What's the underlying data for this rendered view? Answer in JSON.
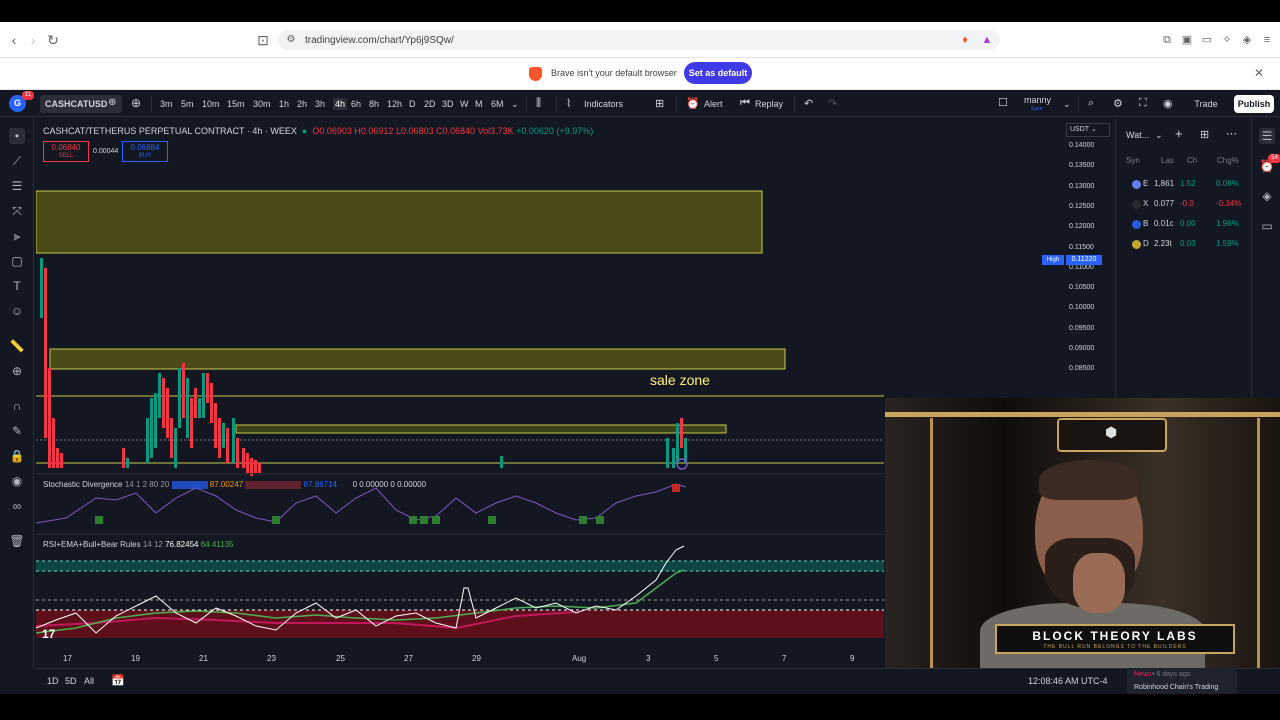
{
  "browser": {
    "url": "tradingview.com/chart/Yp6j9SQw/",
    "notification_text": "Brave isn't your default browser",
    "notification_button": "Set as default"
  },
  "toolbar": {
    "avatar_letter": "G",
    "avatar_badge": "11",
    "symbol": "CASHCATUSD",
    "intervals": [
      "3m",
      "5m",
      "10m",
      "15m",
      "30m",
      "1h",
      "2h",
      "3h",
      "4h",
      "6h",
      "8h",
      "12h",
      "D",
      "2D",
      "3D",
      "W",
      "M",
      "6M"
    ],
    "active_interval": "4h",
    "indicators_label": "Indicators",
    "alert_label": "Alert",
    "replay_label": "Replay",
    "user_name": "manny",
    "user_sub": "Save",
    "trade_label": "Trade",
    "publish_label": "Publish"
  },
  "legend": {
    "title": "CASHCAT/TETHERUS PERPETUAL CONTRACT · 4h · WEEX",
    "open": "O0.06903",
    "high": "H0.06912",
    "low": "L0.06803",
    "close": "C0.06840",
    "volume": "Vol3.73K",
    "change": "+0.00620 (+9.97%)",
    "sell_price": "0.06840",
    "sell_label": "SELL",
    "spread": "0.00044",
    "buy_price": "0.06884",
    "buy_label": "BUY"
  },
  "annotations": {
    "sale_zone": "sale zone"
  },
  "indicators": {
    "stoch_name": "Stochastic Divergence",
    "stoch_params": "14 1 2 80 20",
    "stoch_v1": "87.00247",
    "stoch_v2": "87.86714",
    "stoch_v3": "0",
    "stoch_v4": "0.00000",
    "stoch_v5": "0",
    "stoch_v6": "0.00000",
    "rsi_name": "RSI+EMA+Bull+Bear Rules",
    "rsi_params": "14 12",
    "rsi_v1": "76.82454",
    "rsi_v2": "64.41135"
  },
  "price_axis": {
    "currency": "USDT",
    "ticks": [
      "0.14000",
      "0.13500",
      "0.13000",
      "0.12500",
      "0.12000",
      "0.11500",
      "0.11000",
      "0.10500",
      "0.10000",
      "0.09500",
      "0.09000",
      "0.08500"
    ],
    "high_label": "High",
    "high_value": "0.11220"
  },
  "time_axis": {
    "ticks": [
      "17",
      "19",
      "21",
      "23",
      "25",
      "27",
      "29",
      "Aug",
      "3",
      "5",
      "7",
      "9"
    ]
  },
  "bottom_bar": {
    "ranges": [
      "1D",
      "5D",
      "All"
    ],
    "clock": "12:08:46 AM UTC-4",
    "news_tag": "News",
    "news_meta": "• 6 days ago",
    "news_title": "Robinhood Chain's Trading"
  },
  "watchlist": {
    "title": "Wat...",
    "columns": [
      "Syn",
      "Las",
      "Ch",
      "Chg%"
    ],
    "rows": [
      {
        "sym": "E",
        "last": "1,861",
        "chg": "1.52",
        "pct": "0.08%",
        "dir": "up",
        "color": "#627eea"
      },
      {
        "sym": "X",
        "last": "0.077",
        "chg": "-0.0",
        "pct": "-0.34%",
        "dir": "down",
        "color": "#23292f"
      },
      {
        "sym": "B",
        "last": "0.01c",
        "chg": "0.00",
        "pct": "1.96%",
        "dir": "up",
        "color": "#2a5ada"
      },
      {
        "sym": "D",
        "last": "2.23t",
        "chg": "0.03",
        "pct": "1.59%",
        "dir": "up",
        "color": "#c2a633"
      }
    ],
    "badge": "54"
  },
  "webcam": {
    "banner": "BLOCK THEORY LABS",
    "banner_sub": "THE BULL RUN BELONGS TO THE BUILDERS"
  },
  "colors": {
    "up": "#089981",
    "down": "#f23645",
    "zone": "#7a7a1a",
    "accent": "#2962ff"
  }
}
